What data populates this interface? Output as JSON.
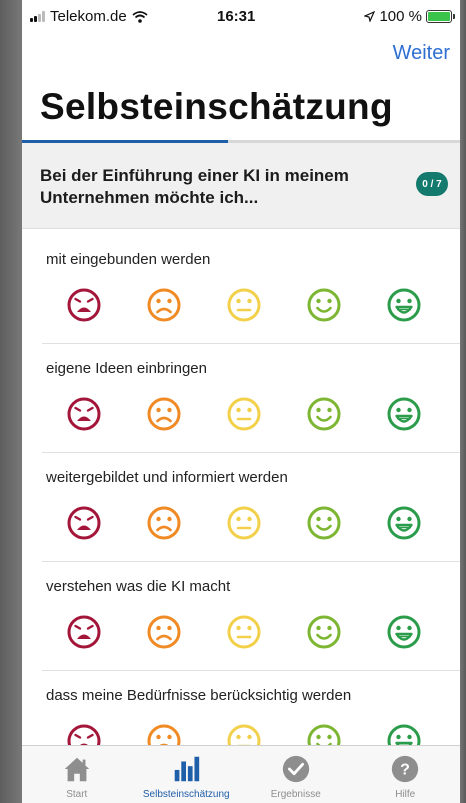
{
  "status_bar": {
    "carrier": "Telekom.de",
    "time": "16:31",
    "battery": "100 %"
  },
  "nav": {
    "next_label": "Weiter"
  },
  "page_title": "Selbsteinschätzung",
  "progress_fraction": 0.47,
  "question": {
    "text": "Bei der Einführung einer KI in meinem Unternehmen möchte ich...",
    "counter": "0 / 7"
  },
  "items": [
    {
      "label": "mit eingebunden werden"
    },
    {
      "label": "eigene Ideen einbringen"
    },
    {
      "label": "weitergebildet und informiert werden"
    },
    {
      "label": "verstehen was die KI macht"
    },
    {
      "label": "dass meine Bedürfnisse berücksichtig werden"
    }
  ],
  "rating_colors": [
    "#a3163a",
    "#f08a24",
    "#f2d04a",
    "#7cb632",
    "#2a9c4a"
  ],
  "rating_icons": [
    "very-sad-face-icon",
    "sad-face-icon",
    "neutral-face-icon",
    "smile-face-icon",
    "grin-face-icon"
  ],
  "tabs": [
    {
      "label": "Start",
      "icon": "home-icon",
      "active": false
    },
    {
      "label": "Selbsteinschätzung",
      "icon": "bar-chart-icon",
      "active": true
    },
    {
      "label": "Ergebnisse",
      "icon": "check-circle-icon",
      "active": false
    },
    {
      "label": "Hilfe",
      "icon": "question-circle-icon",
      "active": false
    }
  ],
  "colors": {
    "accent": "#2f6fd1",
    "active_tab": "#1f5ea8",
    "counter_badge": "#157a6e",
    "inactive_tab": "#8e8e8e"
  }
}
